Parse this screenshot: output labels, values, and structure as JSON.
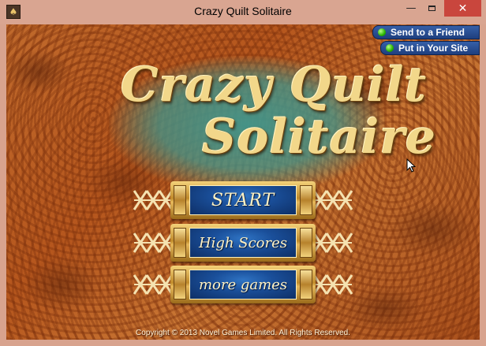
{
  "window": {
    "title": "Crazy Quilt Solitaire",
    "controls": {
      "minimize": "—",
      "close": "✕"
    }
  },
  "top_links": {
    "send": "Send to a Friend",
    "put": "Put in Your Site"
  },
  "logo": {
    "line1": "Crazy Quilt",
    "line2": "Solitaire"
  },
  "menu": {
    "start": "START",
    "high_scores": "High Scores",
    "more_games": "more games"
  },
  "footer": {
    "copyright": "Copyright © 2013 Novel Games Limited. All Rights Reserved."
  },
  "colors": {
    "background": "#b5561d",
    "logo_glow": "#40968c",
    "button_face": "#1a4f9a",
    "gold": "#e6b85a",
    "close_button": "#c9463d"
  },
  "icons": [
    "app-icon",
    "status-dot-icon",
    "lattice-decoration-icon",
    "mouse-cursor-icon"
  ]
}
